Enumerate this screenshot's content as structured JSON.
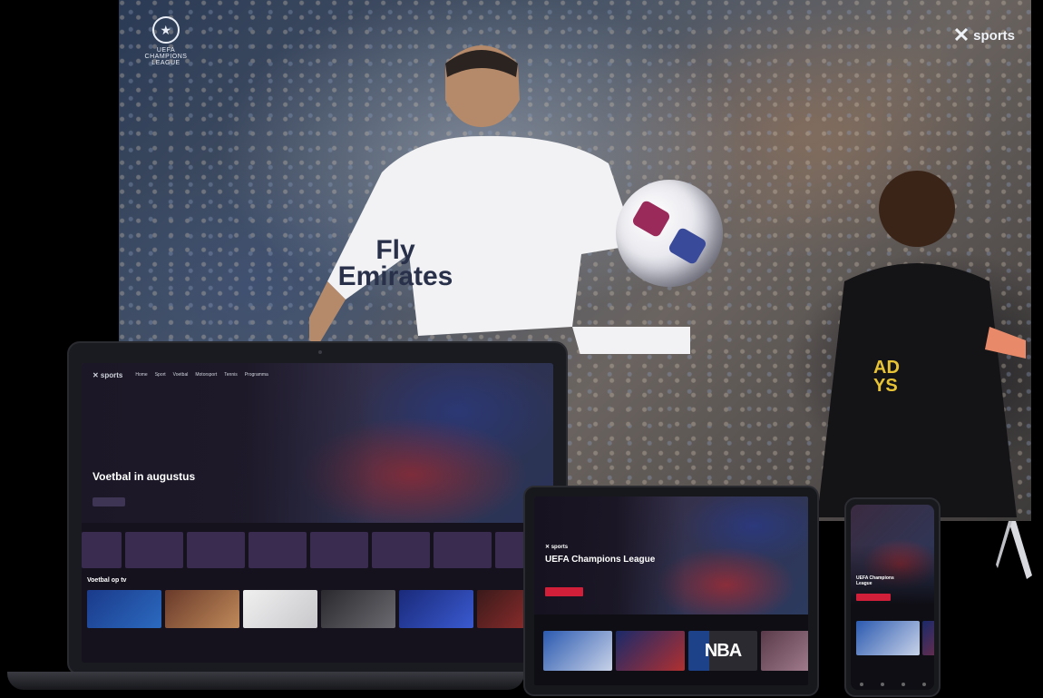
{
  "tv": {
    "league_logo": {
      "line1": "UEFA",
      "line2": "CHAMPIONS",
      "line3": "LEAGUE"
    },
    "brand": {
      "mark": "✕",
      "name": "sports"
    },
    "jersey_sponsor": {
      "line1": "Fly",
      "line2": "Emirates"
    },
    "jersey_sponsor_2": {
      "line1": "AD",
      "line2": "YS"
    }
  },
  "laptop": {
    "brand": "✕ sports",
    "nav": [
      "Home",
      "Sport",
      "Voetbal",
      "Motorsport",
      "Tennis",
      "Programma"
    ],
    "hero_title": "Voetbal in augustus",
    "hero_subtitle": "",
    "hero_button": "",
    "categories": [
      "",
      "",
      "",
      "",
      "",
      "",
      "",
      ""
    ],
    "row_title": "Voetbal op tv"
  },
  "tablet": {
    "brand": "✕ sports",
    "hero_title": "UEFA Champions League",
    "row_title": "",
    "thumb_nba": "NBA"
  },
  "phone": {
    "hero_title": "UEFA Champions League"
  },
  "colors": {
    "accent": "#d11f3a",
    "category_tile": "#3a2b50",
    "background": "#000000"
  }
}
